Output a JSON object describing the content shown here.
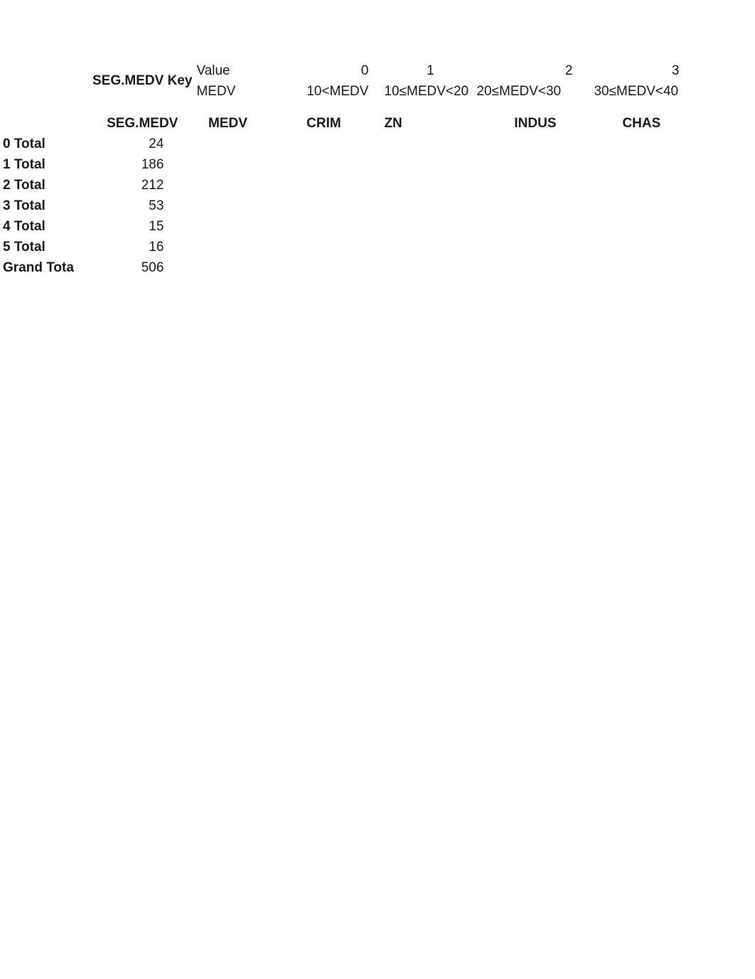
{
  "key_header": {
    "label": "SEG.MEDV Key",
    "row1": {
      "c3": "Value",
      "c4": "0",
      "c5": "1",
      "c6": "2",
      "c7": "3"
    },
    "row2": {
      "c3": "MEDV",
      "c4": "10<MEDV",
      "c5": "10≤MEDV<20",
      "c6": "20≤MEDV<30",
      "c7": "30≤MEDV<40"
    }
  },
  "columns": {
    "c2": "SEG.MEDV",
    "c3": "MEDV",
    "c4": "CRIM",
    "c5": "ZN",
    "c6": "INDUS",
    "c7": "CHAS"
  },
  "rows": [
    {
      "label": "0 Total",
      "value": "24"
    },
    {
      "label": "1 Total",
      "value": "186"
    },
    {
      "label": "2 Total",
      "value": "212"
    },
    {
      "label": "3 Total",
      "value": "53"
    },
    {
      "label": "4 Total",
      "value": "15"
    },
    {
      "label": "5 Total",
      "value": "16"
    },
    {
      "label": "Grand Tota",
      "value": "506"
    }
  ]
}
